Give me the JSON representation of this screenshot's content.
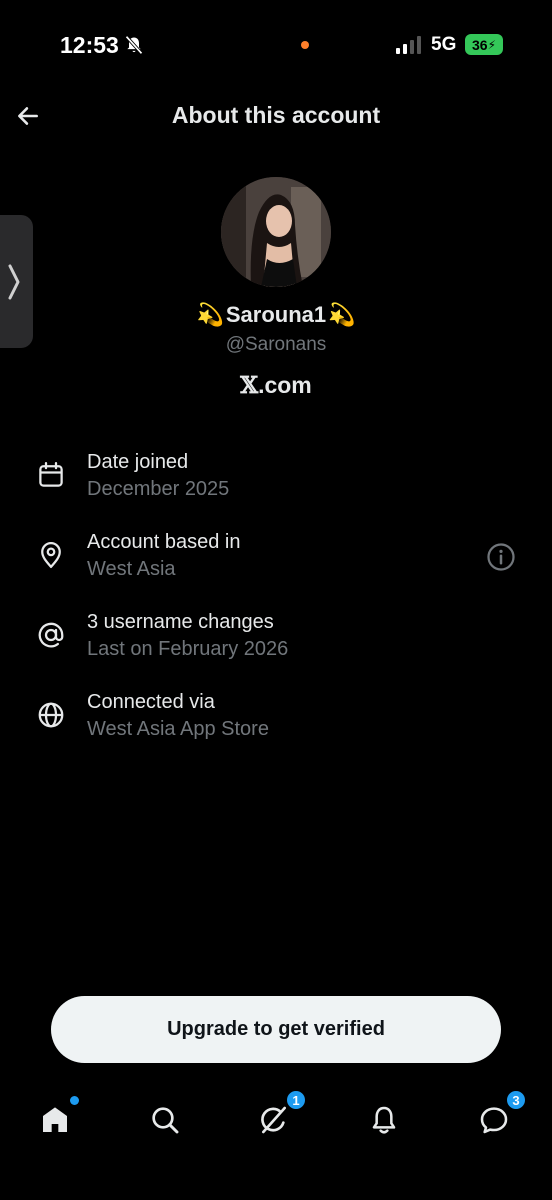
{
  "status_bar": {
    "time": "12:53",
    "network": "5G",
    "battery": "36",
    "icons": [
      "bell-slash-icon",
      "signal-bars-icon",
      "battery-charging-icon"
    ]
  },
  "header": {
    "title": "About this account",
    "back_icon": "arrow-left-icon"
  },
  "profile": {
    "display_name": "Sarouna1",
    "name_emoji": "💫",
    "handle": "@Saronans",
    "site_x": "𝕏",
    "site_rest": ".com"
  },
  "info": [
    {
      "icon": "calendar-icon",
      "title": "Date joined",
      "subtitle": "December 2025"
    },
    {
      "icon": "location-pin-icon",
      "title": "Account based in",
      "subtitle": "West Asia"
    },
    {
      "icon": "at-sign-icon",
      "title": "3 username changes",
      "subtitle": "Last on February 2026"
    },
    {
      "icon": "globe-icon",
      "title": "Connected via",
      "subtitle": "West Asia App Store"
    }
  ],
  "upgrade": {
    "label": "Upgrade to get verified"
  },
  "tabs": {
    "home": {
      "icon": "home-icon"
    },
    "search": {
      "icon": "search-icon"
    },
    "grok": {
      "icon": "grok-icon",
      "badge": "1"
    },
    "notifications": {
      "icon": "bell-icon"
    },
    "messages": {
      "icon": "chat-bubble-icon",
      "badge": "3"
    }
  },
  "colors": {
    "background": "#000000",
    "primary_text": "#e7e9ea",
    "secondary_text": "#71767b",
    "accent": "#1d9bf0",
    "button_bg": "#eff3f4",
    "battery": "#34c759"
  }
}
